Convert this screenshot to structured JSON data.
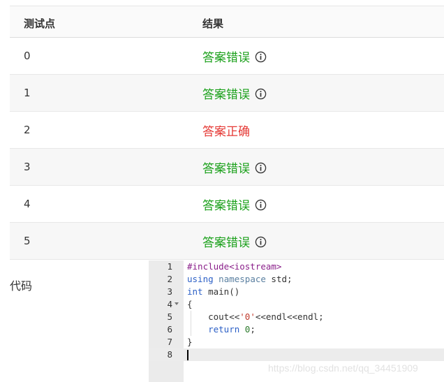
{
  "table": {
    "headers": {
      "point": "测试点",
      "result": "结果"
    },
    "rows": [
      {
        "point": "0",
        "status": "答案错误",
        "type": "wrong",
        "info": true
      },
      {
        "point": "1",
        "status": "答案错误",
        "type": "wrong",
        "info": true
      },
      {
        "point": "2",
        "status": "答案正确",
        "type": "right",
        "info": false
      },
      {
        "point": "3",
        "status": "答案错误",
        "type": "wrong",
        "info": true
      },
      {
        "point": "4",
        "status": "答案错误",
        "type": "wrong",
        "info": true
      },
      {
        "point": "5",
        "status": "答案错误",
        "type": "wrong",
        "info": true
      }
    ]
  },
  "code_section": {
    "label": "代码"
  },
  "editor": {
    "line_numbers": [
      "1",
      "2",
      "3",
      "4",
      "5",
      "6",
      "7",
      "8"
    ],
    "lines": [
      "#include<iostream>",
      "using namespace std;",
      "int main()",
      "{",
      "    cout<<'0'<<endl<<endl;",
      "    return 0;",
      "}",
      ""
    ]
  },
  "watermark": "https://blog.csdn.net/qq_34451909",
  "colors": {
    "wrong": "#1aa01a",
    "right": "#e53935"
  }
}
